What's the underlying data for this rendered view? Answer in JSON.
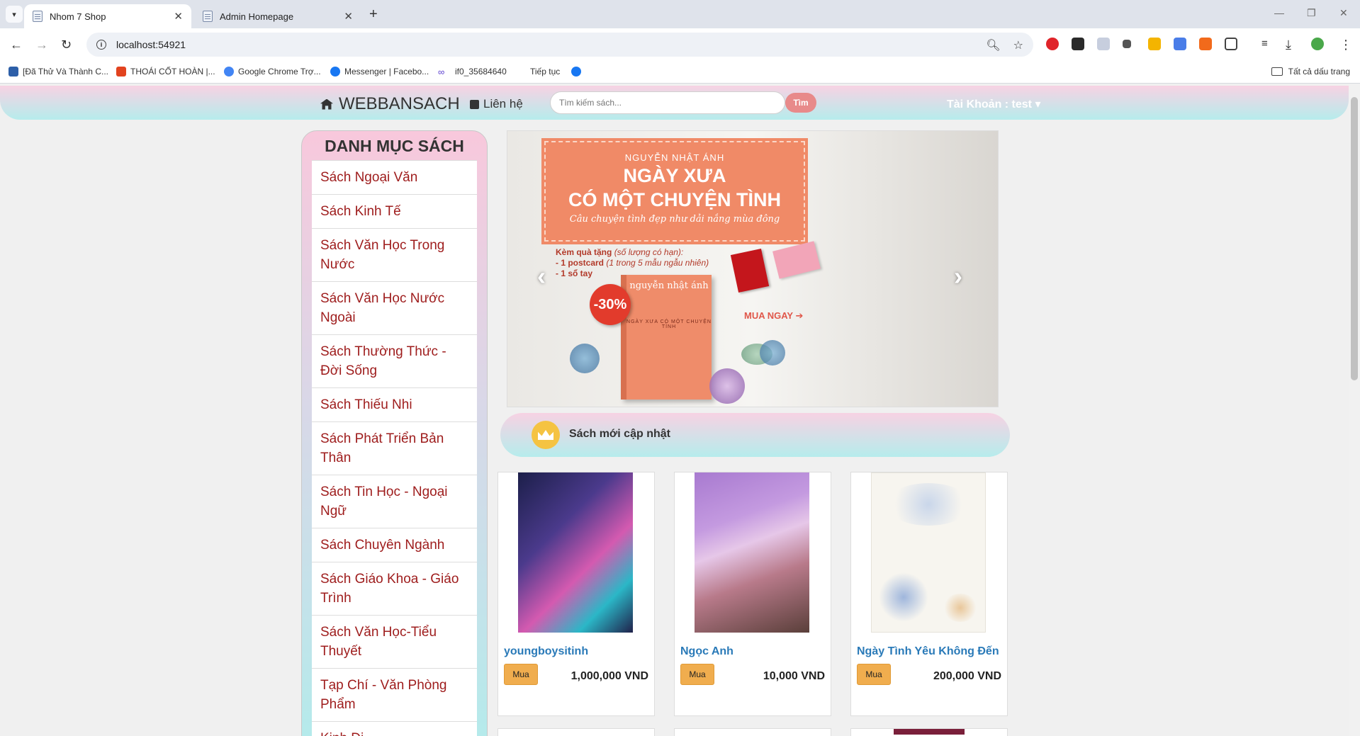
{
  "browser": {
    "tabs": [
      {
        "title": "Nhom 7 Shop"
      },
      {
        "title": "Admin Homepage"
      }
    ],
    "url": "localhost:54921",
    "bookmarks": [
      "[Đã Thử Và Thành C...",
      "THOÁI CỐT HOÀN |...",
      "Google Chrome Trợ...",
      "Messenger | Facebo...",
      "if0_35684640",
      "Tiếp tục"
    ],
    "bookmarks_all": "Tất cả dấu trang"
  },
  "site": {
    "brand": "WEBBANSACH",
    "contact": "Liên hệ",
    "search_placeholder": "Tìm kiếm sách...",
    "search_button": "Tìm",
    "account": "Tài Khoản : test ▾"
  },
  "sidebar": {
    "title": "DANH MỤC SÁCH",
    "categories": [
      "Sách Ngoại Văn",
      "Sách Kinh Tế",
      "Sách Văn Học Trong Nước",
      "Sách Văn Học Nước Ngoài",
      "Sách Thường Thức - Đời Sống",
      "Sách Thiếu Nhi",
      "Sách Phát Triển Bản Thân",
      "Sách Tin Học - Ngoại Ngữ",
      "Sách Chuyên Ngành",
      "Sách Giáo Khoa - Giáo Trình",
      "Sách Văn Học-Tiểu Thuyết",
      "Tạp Chí - Văn Phòng Phẩm",
      "Kinh Dị"
    ]
  },
  "banner": {
    "author": "NGUYỄN NHẬT ÁNH",
    "title_line1": "NGÀY XƯA",
    "title_line2": "CÓ MỘT CHUYỆN TÌNH",
    "subtitle": "Câu chuyện tình đẹp như dải nắng mùa đông",
    "gift_line1": "Kèm quà tặng",
    "gift_note1": "(số lượng có hạn):",
    "gift_line2": "- 1 postcard",
    "gift_note2": "(1 trong 5 mẫu ngẫu nhiên)",
    "gift_line3": "- 1 sổ tay",
    "discount": "-30%",
    "book_author": "nguyễn nhật ánh",
    "book_title": "NGÀY XƯA CÓ MỘT CHUYỆN TÌNH",
    "cta": "MUA NGAY ➔"
  },
  "section": {
    "title": "Sách mới cập nhật"
  },
  "products": [
    {
      "name": "youngboysitinh",
      "price": "1,000,000 VND",
      "buy": "Mua"
    },
    {
      "name": "Ngọc Anh",
      "price": "10,000 VND",
      "buy": "Mua"
    },
    {
      "name": "Ngày Tình Yêu Không Đến",
      "price": "200,000 VND",
      "buy": "Mua"
    }
  ],
  "colors": {
    "accent_pink": "#f7d2e3",
    "accent_cyan": "#b6ecec",
    "category_text": "#9e1c1c",
    "product_name": "#2a7ab8",
    "buy_button": "#f0ad4e",
    "search_button": "#e88a8a"
  }
}
